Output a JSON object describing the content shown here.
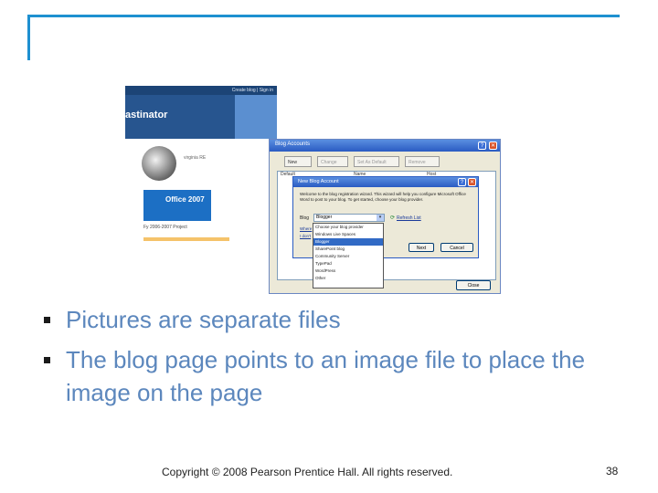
{
  "slide": {
    "bullets": [
      "Pictures are separate files",
      "The blog page points to an image file to place the image on the page"
    ],
    "footer": "Copyright © 2008 Pearson Prentice Hall. All rights reserved.",
    "page_number": "38",
    "accent_color": "#1e90d0",
    "bullet_text_color": "#5c87bd"
  },
  "blog_page": {
    "top_links": "Create blog | Sign in",
    "title": "astinator",
    "watch_caption": "virginia RE",
    "office_label": "Office 2007",
    "caption": "Fy 2006-2007 Project"
  },
  "blog_accounts_dialog": {
    "title": "Blog Accounts",
    "toolbar": {
      "new": "New",
      "change": "Change",
      "set_default": "Set As Default",
      "remove": "Remove"
    },
    "columns": [
      "Default",
      "Name",
      "Host"
    ],
    "close_label": "Close"
  },
  "new_blog_account_dialog": {
    "title": "New Blog Account",
    "description": "Welcome to the blog registration wizard. This wizard will help you configure Microsoft Office Word to post to your blog. To get started, choose your blog provider.",
    "blog_label": "Blog",
    "blog_selected": "Blogger",
    "refresh_label": "Refresh List",
    "link1": "Where",
    "link2": "I don't",
    "next_label": "Next",
    "cancel_label": "Cancel"
  },
  "dropdown": {
    "options": [
      "Choose your blog provider",
      "Windows Live Spaces",
      "Blogger",
      "SharePoint blog",
      "Community Server",
      "TypePad",
      "WordPress",
      "Other"
    ],
    "selected_index": 2
  }
}
